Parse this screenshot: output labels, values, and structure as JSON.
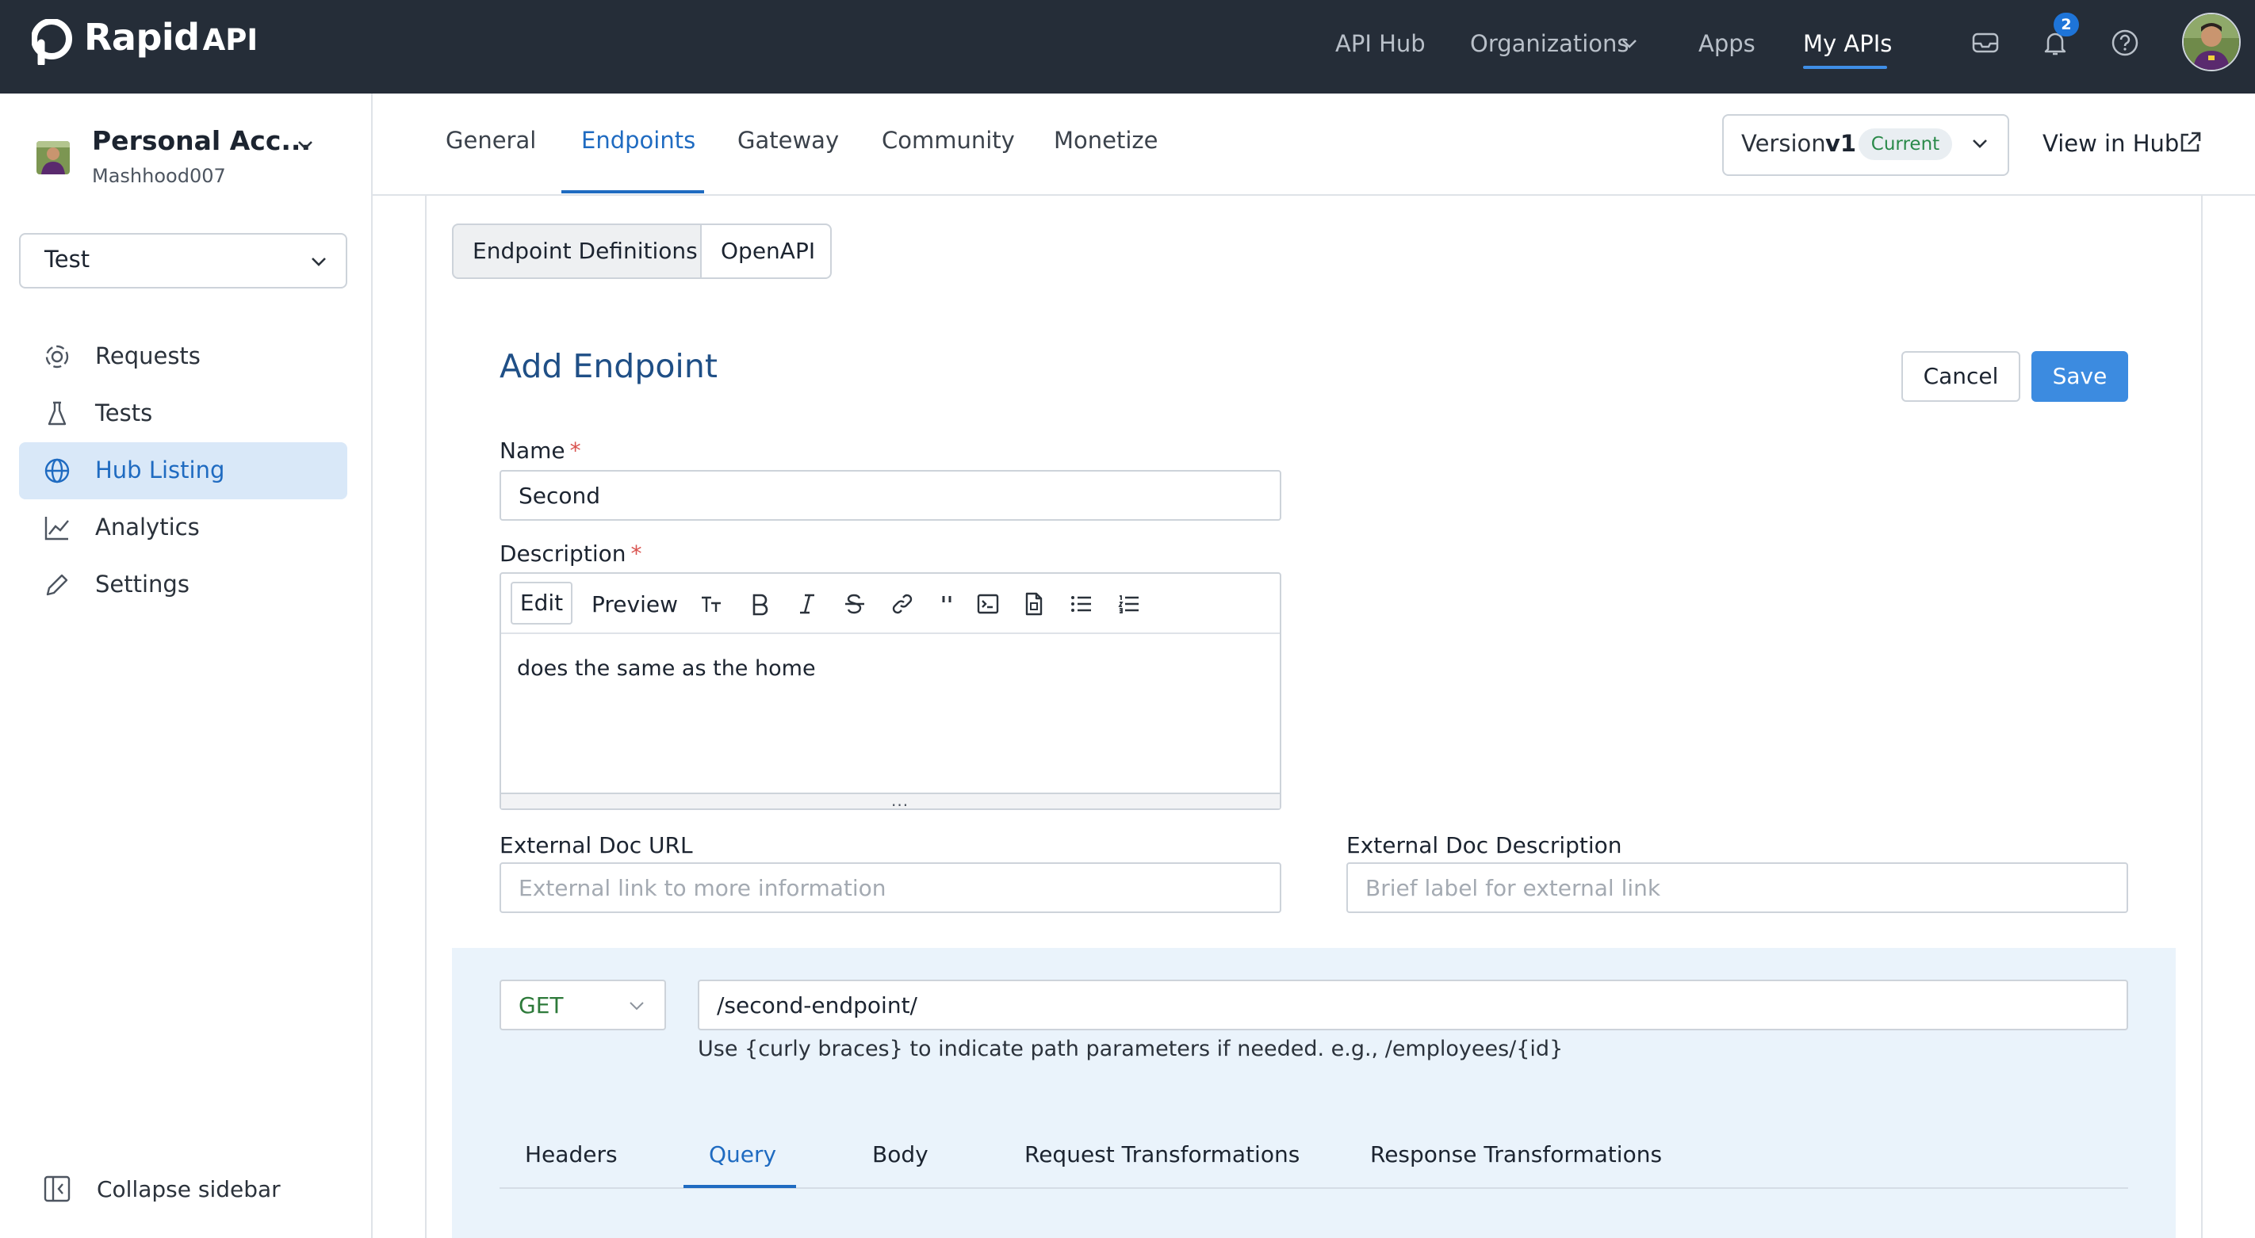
{
  "brand": {
    "name_main": "Rapid",
    "name_suffix": "API"
  },
  "topnav": {
    "links": [
      "API Hub",
      "Organizations",
      "Apps",
      "My APIs"
    ],
    "active": "My APIs",
    "notification_count": "2"
  },
  "sidebar": {
    "account_name": "Personal Acc...",
    "account_user": "Mashhood007",
    "environment": "Test",
    "items": [
      {
        "label": "Requests",
        "icon": "requests-icon"
      },
      {
        "label": "Tests",
        "icon": "flask-icon"
      },
      {
        "label": "Hub Listing",
        "icon": "globe-icon",
        "active": true
      },
      {
        "label": "Analytics",
        "icon": "chart-icon"
      },
      {
        "label": "Settings",
        "icon": "pencil-icon"
      }
    ],
    "collapse_label": "Collapse sidebar"
  },
  "tabs": [
    "General",
    "Endpoints",
    "Gateway",
    "Community",
    "Monetize"
  ],
  "active_tab": "Endpoints",
  "version": {
    "label": "Version",
    "value": "v1",
    "status": "Current"
  },
  "view_in_hub": "View in Hub",
  "segmented": {
    "left": "Endpoint Definitions",
    "right": "OpenAPI",
    "selected": "Endpoint Definitions"
  },
  "form": {
    "title": "Add Endpoint",
    "cancel_label": "Cancel",
    "save_label": "Save",
    "name_label": "Name",
    "required_mark": "*",
    "name_value": "Second",
    "description_label": "Description",
    "editor": {
      "edit_label": "Edit",
      "preview_label": "Preview",
      "text": "does the same as the home",
      "resize_handle": "..."
    },
    "ext_doc_url_label": "External Doc URL",
    "ext_doc_url_placeholder": "External link to more information",
    "ext_doc_desc_label": "External Doc Description",
    "ext_doc_desc_placeholder": "Brief label for external link"
  },
  "request": {
    "method": "GET",
    "path": "/second-endpoint/",
    "hint": "Use {curly braces} to indicate path parameters if needed. e.g., /employees/{id}",
    "sub_tabs": [
      "Headers",
      "Query",
      "Body",
      "Request Transformations",
      "Response Transformations"
    ],
    "active_sub_tab": "Query"
  },
  "colors": {
    "topbar": "#252d38",
    "accent": "#1f6bc1",
    "save_button": "#3c8be0",
    "active_sidebar_bg": "#d9e8f8",
    "request_area_bg": "#eaf3fb",
    "method_green": "#2d7a3a",
    "required_red": "#d9534f"
  }
}
